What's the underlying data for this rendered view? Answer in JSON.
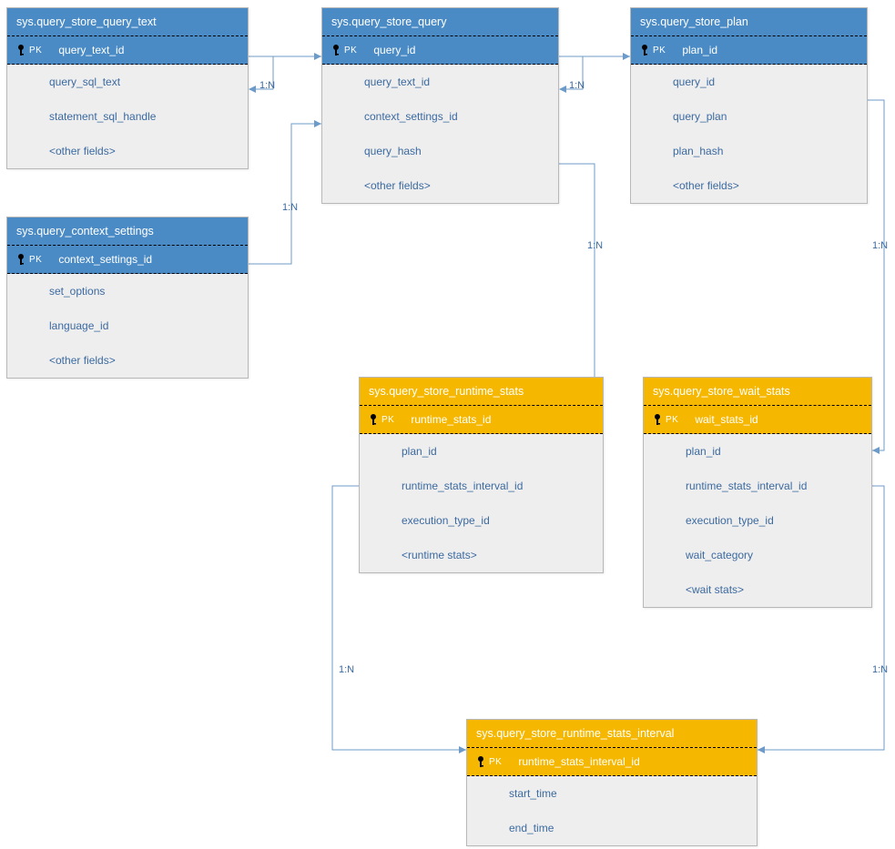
{
  "entities": {
    "query_text": {
      "title": "sys.query_store_query_text",
      "pk": "query_text_id",
      "fields": [
        "query_sql_text",
        "statement_sql_handle",
        "<other fields>"
      ]
    },
    "query": {
      "title": "sys.query_store_query",
      "pk": "query_id",
      "fields": [
        "query_text_id",
        "context_settings_id",
        "query_hash",
        "<other fields>"
      ]
    },
    "plan": {
      "title": "sys.query_store_plan",
      "pk": "plan_id",
      "fields": [
        "query_id",
        "query_plan",
        "plan_hash",
        "<other fields>"
      ]
    },
    "context": {
      "title": "sys.query_context_settings",
      "pk": "context_settings_id",
      "fields": [
        "set_options",
        "language_id",
        "<other fields>"
      ]
    },
    "runtime": {
      "title": "sys.query_store_runtime_stats",
      "pk": "runtime_stats_id",
      "fields": [
        "plan_id",
        "runtime_stats_interval_id",
        "execution_type_id",
        "<runtime stats>"
      ]
    },
    "wait": {
      "title": "sys.query_store_wait_stats",
      "pk": "wait_stats_id",
      "fields": [
        "plan_id",
        "runtime_stats_interval_id",
        "execution_type_id",
        "wait_category",
        "<wait stats>"
      ]
    },
    "interval": {
      "title": "sys.query_store_runtime_stats_interval",
      "pk": "runtime_stats_interval_id",
      "fields": [
        "start_time",
        "end_time"
      ]
    }
  },
  "labels": {
    "pk": "PK",
    "rel": "1:N"
  }
}
